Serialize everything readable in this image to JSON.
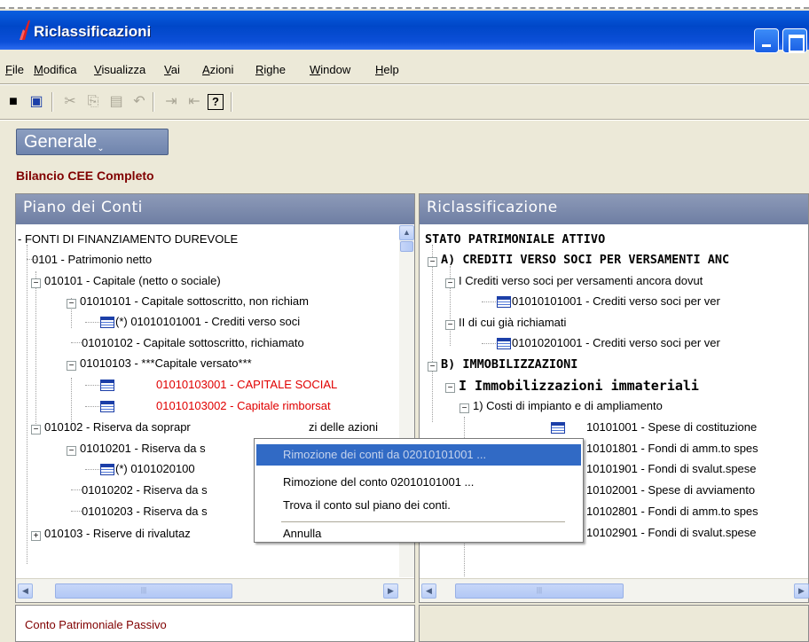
{
  "window": {
    "title": "Riclassificazioni"
  },
  "menu": [
    "File",
    "Modifica",
    "Visualizza",
    "Vai",
    "Azioni",
    "Righe",
    "Window",
    "Help"
  ],
  "toolbar": {
    "buttons": [
      {
        "name": "save-icon",
        "glyph": "■"
      },
      {
        "name": "print-icon",
        "glyph": "▣"
      },
      {
        "name": "cut-icon",
        "glyph": "✂"
      },
      {
        "name": "copy-icon",
        "glyph": "⎘"
      },
      {
        "name": "paste-icon",
        "glyph": "▤"
      },
      {
        "name": "undo-icon",
        "glyph": "↶"
      },
      {
        "name": "indent-icon",
        "glyph": "⇥"
      },
      {
        "name": "outdent-icon",
        "glyph": "⇤"
      },
      {
        "name": "help-icon",
        "glyph": "?"
      }
    ]
  },
  "general_button": {
    "label": "Generale",
    "caret": "⌄"
  },
  "section_title": "Bilancio CEE Completo",
  "left_pane": {
    "header": "Piano dei Conti",
    "rows": [
      "- FONTI DI FINANZIAMENTO DUREVOLE",
      "0101 - Patrimonio netto",
      "010101 - Capitale (netto o sociale)",
      "01010101 - Capitale sottoscritto, non richiam",
      "(*) 01010101001 - Crediti verso soci",
      "01010102 - Capitale sottoscritto, richiamato",
      "01010103 - ***Capitale versato***",
      "01010103001 - CAPITALE SOCIAL",
      "01010103002 - Capitale rimborsat",
      "010102 - Riserva da soprapr",
      "01010201 - Riserva da s",
      "(*) 0101020100",
      "01010202 - Riserva da s",
      "01010203 - Riserva da s",
      "010103 - Riserve di rivalutaz"
    ],
    "row9_tail": "zi delle azioni"
  },
  "right_pane": {
    "header": "Riclassificazione",
    "rows": [
      "STATO PATRIMONIALE ATTIVO",
      "A) CREDITI VERSO SOCI PER VERSAMENTI ANC",
      "I Crediti verso soci per versamenti ancora dovut",
      "01010101001 - Crediti verso soci per ver",
      "II di cui già richiamati",
      "01010201001 - Crediti verso soci per ver",
      "B) IMMOBILIZZAZIONI",
      "I Immobilizzazioni immateriali",
      "1) Costi di impianto e di ampliamento",
      "10101001 - Spese di costituzione",
      "10101801 - Fondi di amm.to spes",
      "10101901 - Fondi di svalut.spese",
      "10102001 - Spese di avviamento",
      "10102801 - Fondi di amm.to spes",
      "10102901 - Fondi di svalut.spese"
    ]
  },
  "footer": {
    "text": "Conto  Patrimoniale Passivo"
  },
  "context_menu": {
    "items": [
      "Rimozione dei conti da 02010101001 ...",
      "Rimozione del conto 02010101001 ...",
      "Trova il conto sul piano dei conti.",
      "Annulla"
    ]
  },
  "colors": {
    "title_bar": "#0047c8",
    "pane_header": "#7d8bae",
    "red_text": "#e00000",
    "highlight": "#316ac5"
  }
}
